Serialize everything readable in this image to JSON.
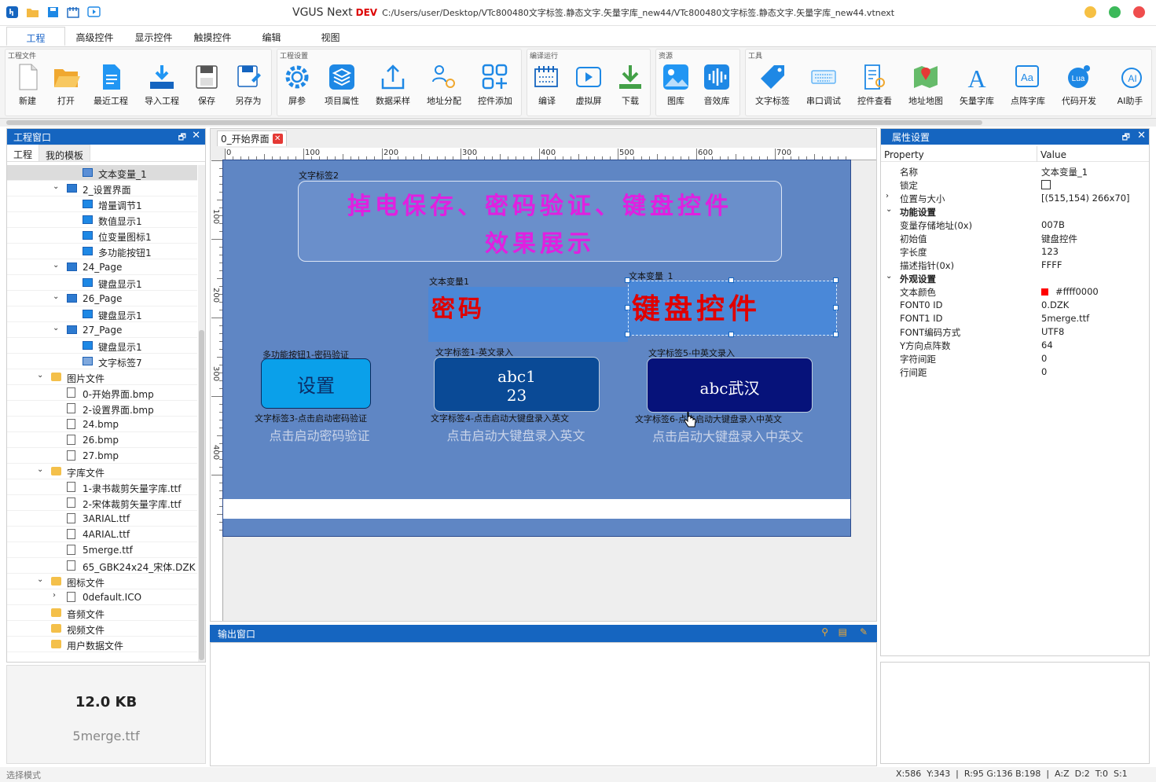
{
  "app": {
    "name": "VGUS Next",
    "dev": "DEV",
    "path": "C:/Users/user/Desktop/VTc800480文字标签.静态文字.矢量字库_new44/VTc800480文字标签.静态文字.矢量字库_new44.vtnext"
  },
  "menu_tabs": [
    "工程",
    "高级控件",
    "显示控件",
    "触摸控件",
    "编辑",
    "视图"
  ],
  "ribbon": {
    "groups": [
      "工程文件",
      "工程设置",
      "编译运行",
      "资源",
      "工具"
    ],
    "buttons": [
      "新建",
      "打开",
      "最近工程",
      "导入工程",
      "保存",
      "另存为",
      "屏参",
      "项目属性",
      "数据采样",
      "地址分配",
      "控件添加",
      "编译",
      "虚拟屏",
      "下载",
      "图库",
      "音效库",
      "文字标签",
      "串口调试",
      "控件查看",
      "地址地图",
      "矢量字库",
      "点阵字库",
      "代码开发",
      "AI助手"
    ]
  },
  "left_panel": {
    "title": "工程窗口",
    "tabs": [
      "工程",
      "我的模板"
    ],
    "tree": [
      {
        "label": "文本变量_1",
        "level": 3,
        "icon": "text-var",
        "sel": true
      },
      {
        "label": "2_设置界面",
        "level": 2,
        "icon": "page",
        "exp": "v"
      },
      {
        "label": "增量调节1",
        "level": 3,
        "icon": "increment"
      },
      {
        "label": "数值显示1",
        "level": 3,
        "icon": "number"
      },
      {
        "label": "位变量图标1",
        "level": 3,
        "icon": "bit-icon"
      },
      {
        "label": "多功能按钮1",
        "level": 3,
        "icon": "button"
      },
      {
        "label": "24_Page",
        "level": 2,
        "icon": "page",
        "exp": "v"
      },
      {
        "label": "键盘显示1",
        "level": 3,
        "icon": "keyboard"
      },
      {
        "label": "26_Page",
        "level": 2,
        "icon": "page",
        "exp": "v"
      },
      {
        "label": "键盘显示1",
        "level": 3,
        "icon": "keyboard"
      },
      {
        "label": "27_Page",
        "level": 2,
        "icon": "page",
        "exp": "v"
      },
      {
        "label": "键盘显示1",
        "level": 3,
        "icon": "keyboard"
      },
      {
        "label": "文字标签7",
        "level": 3,
        "icon": "text-label"
      },
      {
        "label": "图片文件",
        "level": 1,
        "icon": "folder",
        "exp": "v"
      },
      {
        "label": "0-开始界面.bmp",
        "level": 2,
        "icon": "file"
      },
      {
        "label": "2-设置界面.bmp",
        "level": 2,
        "icon": "file"
      },
      {
        "label": "24.bmp",
        "level": 2,
        "icon": "file"
      },
      {
        "label": "26.bmp",
        "level": 2,
        "icon": "file"
      },
      {
        "label": "27.bmp",
        "level": 2,
        "icon": "file"
      },
      {
        "label": "字库文件",
        "level": 1,
        "icon": "folder",
        "exp": "v"
      },
      {
        "label": "1-隶书裁剪矢量字库.ttf",
        "level": 2,
        "icon": "font-file"
      },
      {
        "label": "2-宋体裁剪矢量字库.ttf",
        "level": 2,
        "icon": "font-file"
      },
      {
        "label": "3ARIAL.ttf",
        "level": 2,
        "icon": "font-file"
      },
      {
        "label": "4ARIAL.ttf",
        "level": 2,
        "icon": "font-file"
      },
      {
        "label": "5merge.ttf",
        "level": 2,
        "icon": "font-file"
      },
      {
        "label": "65_GBK24x24_宋体.DZK",
        "level": 2,
        "icon": "font-file"
      },
      {
        "label": "图标文件",
        "level": 1,
        "icon": "folder",
        "exp": "v"
      },
      {
        "label": "0default.ICO",
        "level": 2,
        "icon": "ico-file",
        "exp": ">"
      },
      {
        "label": "音频文件",
        "level": 1,
        "icon": "folder"
      },
      {
        "label": "视频文件",
        "level": 1,
        "icon": "folder"
      },
      {
        "label": "用户数据文件",
        "level": 1,
        "icon": "folder"
      }
    ],
    "info": {
      "size": "12.0 KB",
      "name": "5merge.ttf"
    }
  },
  "doc_tab": "0_开始界面",
  "ruler": {
    "h": [
      "0",
      "100",
      "200",
      "300",
      "400",
      "500",
      "600",
      "700"
    ],
    "v": [
      "100",
      "200",
      "300",
      "400"
    ]
  },
  "canvas": {
    "label2_cap": "文字标签2",
    "label2_text1": "掉电保存、密码验证、键盘控件",
    "label2_text2": "效果展示",
    "var1_cap": "文本变量1",
    "var1_text": "密码",
    "var_1_cap": "文本变量_1",
    "var_1_text": "键盘控件",
    "btn1_cap": "多功能按钮1-密码验证",
    "btn1_text": "设置",
    "kbd1_cap": "文字标签1-英文录入",
    "kbd1_text1": "abc1",
    "kbd1_text2": "23",
    "kbd5_cap": "文字标签5-中英文录入",
    "kbd5_text": "abc武汉",
    "hint3_cap": "文字标签3-点击启动密码验证",
    "hint3_text": "点击启动密码验证",
    "hint4_cap": "文字标签4-点击启动大键盘录入英文",
    "hint4_text": "点击启动大键盘录入英文",
    "hint6_cap": "文字标签6-点击启动大键盘录入中英文",
    "hint6_text": "点击启动大键盘录入中英文"
  },
  "output": {
    "title": "输出窗口"
  },
  "properties": {
    "title": "属性设置",
    "col_property": "Property",
    "col_value": "Value",
    "rows": [
      {
        "k": "名称",
        "v": "文本变量_1"
      },
      {
        "k": "锁定",
        "v": "",
        "type": "checkbox"
      },
      {
        "k": "位置与大小",
        "v": "[(515,154) 266x70]",
        "arr": ">"
      },
      {
        "k": "功能设置",
        "v": "",
        "type": "section",
        "arr": "v"
      },
      {
        "k": "变量存储地址(0x)",
        "v": "007B"
      },
      {
        "k": "初始值",
        "v": "键盘控件"
      },
      {
        "k": "字长度",
        "v": "123"
      },
      {
        "k": "描述指针(0x)",
        "v": "FFFF"
      },
      {
        "k": "外观设置",
        "v": "",
        "type": "section",
        "arr": "v"
      },
      {
        "k": "文本颜色",
        "v": "#ffff0000",
        "type": "color"
      },
      {
        "k": "FONT0 ID",
        "v": "0.DZK"
      },
      {
        "k": "FONT1 ID",
        "v": "5merge.ttf"
      },
      {
        "k": "FONT编码方式",
        "v": "UTF8"
      },
      {
        "k": "Y方向点阵数",
        "v": "64"
      },
      {
        "k": "字符间距",
        "v": "0"
      },
      {
        "k": "行间距",
        "v": "0"
      }
    ]
  },
  "status": {
    "left": "选择模式",
    "right": "X:586  Y:343  |  R:95 G:136 B:198  |  A:Z  D:2  T:0  S:1"
  },
  "colors": {
    "accent": "#1565c0",
    "screen_bg": "#5f86c4",
    "magenta": "#e020e0",
    "red": "#e00000",
    "sel_blue": "#4a88d8"
  }
}
